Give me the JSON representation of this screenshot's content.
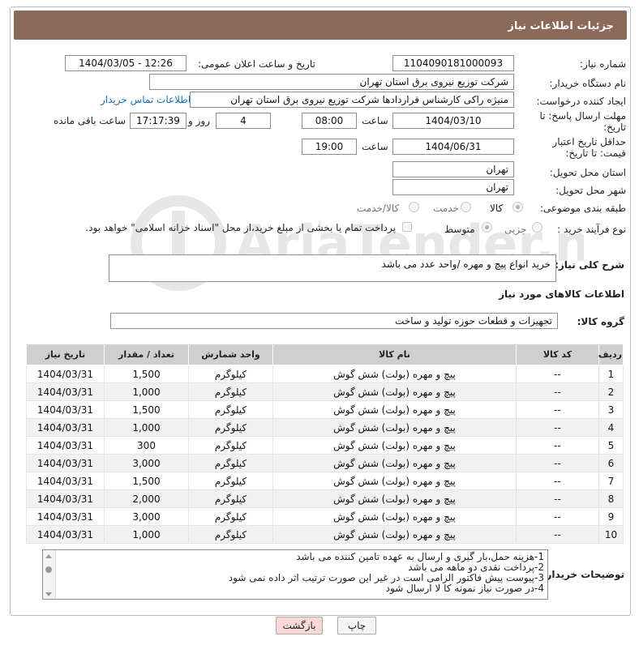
{
  "header": {
    "title": "جزئیات اطلاعات نیاز"
  },
  "fields": {
    "need_number_label": "شماره نیاز:",
    "need_number": "1104090181000093",
    "announce_label": "تاریخ و ساعت اعلان عمومی:",
    "announce_value": "1404/03/05 - 12:26",
    "buyer_label": "نام دستگاه خریدار:",
    "buyer_value": "شرکت توزیع نیروی برق استان تهران",
    "creator_label": "ایجاد کننده درخواست:",
    "creator_value": "منیژه راکی کارشناس قراردادها شرکت توزیع نیروی برق استان تهران",
    "contact_link": "اطلاعات تماس خریدار",
    "deadline_label": "مهلت ارسال پاسخ: تا تاریخ:",
    "deadline_date": "1404/03/10",
    "time_label": "ساعت",
    "deadline_time": "08:00",
    "days_value": "4",
    "days_label": "روز و",
    "remaining_time": "17:17:39",
    "remaining_label": "ساعت باقی مانده",
    "validity_label": "حداقل تاریخ اعتبار قیمت: تا تاریخ:",
    "validity_date": "1404/06/31",
    "validity_time": "19:00",
    "province_label": "استان محل تحویل:",
    "province_value": "تهران",
    "city_label": "شهر محل تحویل:",
    "city_value": "تهران",
    "category_label": "طبقه بندی موضوعی:",
    "category_options": [
      "کالا",
      "خدمت",
      "کالا/خدمت"
    ],
    "process_label": "نوع فرآیند خرید :",
    "process_options": [
      "جزیی",
      "متوسط"
    ],
    "payment_note": "پرداخت تمام یا بخشی از مبلغ خرید،از محل \"اسناد خزانه اسلامی\" خواهد بود."
  },
  "description": {
    "label": "شرح کلی نیاز:",
    "value": "خرید انواع پیچ و مهره /واحد عدد می باشد"
  },
  "goods": {
    "section_title": "اطلاعات کالاهای مورد نیاز",
    "group_label": "گروه کالا:",
    "group_value": "تجهیزات و قطعات حوزه تولید و ساخت",
    "columns": [
      "ردیف",
      "کد کالا",
      "نام کالا",
      "واحد شمارش",
      "تعداد / مقدار",
      "تاریخ نیاز"
    ],
    "rows": [
      {
        "n": "1",
        "code": "--",
        "name": "پیچ و مهره (بولت) شش گوش",
        "unit": "کیلوگرم",
        "qty": "1,500",
        "date": "1404/03/31"
      },
      {
        "n": "2",
        "code": "--",
        "name": "پیچ و مهره (بولت) شش گوش",
        "unit": "کیلوگرم",
        "qty": "1,000",
        "date": "1404/03/31"
      },
      {
        "n": "3",
        "code": "--",
        "name": "پیچ و مهره (بولت) شش گوش",
        "unit": "کیلوگرم",
        "qty": "1,500",
        "date": "1404/03/31"
      },
      {
        "n": "4",
        "code": "--",
        "name": "پیچ و مهره (بولت) شش گوش",
        "unit": "کیلوگرم",
        "qty": "1,000",
        "date": "1404/03/31"
      },
      {
        "n": "5",
        "code": "--",
        "name": "پیچ و مهره (بولت) شش گوش",
        "unit": "کیلوگرم",
        "qty": "300",
        "date": "1404/03/31"
      },
      {
        "n": "6",
        "code": "--",
        "name": "پیچ و مهره (بولت) شش گوش",
        "unit": "کیلوگرم",
        "qty": "3,000",
        "date": "1404/03/31"
      },
      {
        "n": "7",
        "code": "--",
        "name": "پیچ و مهره (بولت) شش گوش",
        "unit": "کیلوگرم",
        "qty": "1,500",
        "date": "1404/03/31"
      },
      {
        "n": "8",
        "code": "--",
        "name": "پیچ و مهره (بولت) شش گوش",
        "unit": "کیلوگرم",
        "qty": "2,000",
        "date": "1404/03/31"
      },
      {
        "n": "9",
        "code": "--",
        "name": "پیچ و مهره (بولت) شش گوش",
        "unit": "کیلوگرم",
        "qty": "3,000",
        "date": "1404/03/31"
      },
      {
        "n": "10",
        "code": "--",
        "name": "پیچ و مهره (بولت) شش گوش",
        "unit": "کیلوگرم",
        "qty": "1,000",
        "date": "1404/03/31"
      }
    ]
  },
  "notes": {
    "label": "توضیحات خریدار:",
    "lines": [
      "1-هزینه حمل،بار گیری و ارسال به عهده تامین کننده می باشد",
      "2-پرداخت نقدی دو ماهه می باشد",
      "3-پیوست پیش فاکتور الزامی است در غیر این صورت ترتیب اثر داده نمی شود",
      "4-در صورت نیاز نمونه کا لا ارسال شود"
    ]
  },
  "buttons": {
    "print": "چاپ",
    "back": "بازگشت"
  },
  "watermark": "AriaTender.net",
  "colors": {
    "header_bg": "#8b6a5a",
    "back_button_bg": "#f9d8d8",
    "link": "#1a6fb8"
  }
}
